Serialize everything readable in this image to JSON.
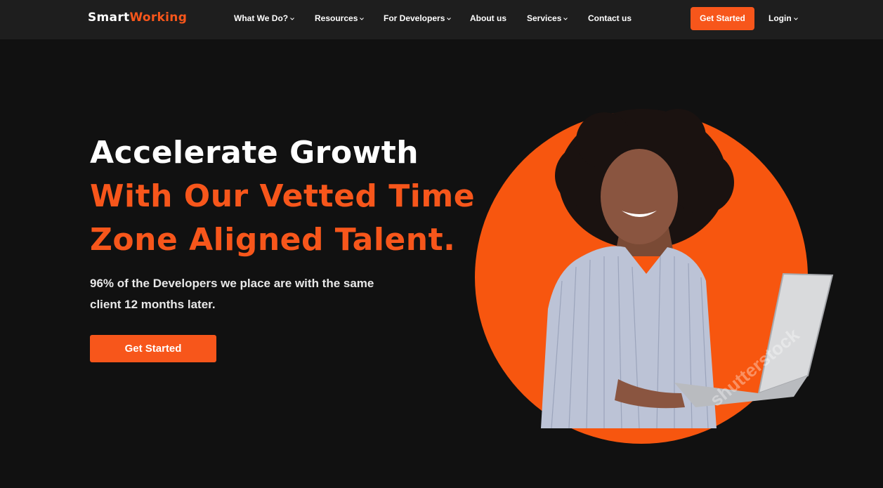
{
  "brand": {
    "name_part1": "Smart",
    "name_part2": "Working",
    "accent": "#f7561b",
    "background": "#111111",
    "nav_background": "#1e1e1e"
  },
  "nav": {
    "items": [
      {
        "label": "What We Do?",
        "dropdown": true
      },
      {
        "label": "Resources",
        "dropdown": true
      },
      {
        "label": "For Developers",
        "dropdown": true
      },
      {
        "label": "About us",
        "dropdown": false
      },
      {
        "label": "Services",
        "dropdown": true
      },
      {
        "label": "Contact us",
        "dropdown": false
      }
    ],
    "cta_label": "Get Started",
    "login_label": "Login"
  },
  "hero": {
    "heading_line1": "Accelerate Growth",
    "heading_line2": "With Our Vetted Time",
    "heading_line3": "Zone Aligned Talent.",
    "subtext": "96% of the Developers we place are with the same client 12 months later.",
    "cta_label": "Get Started",
    "image_subject": "woman-holding-laptop-on-orange-circle",
    "watermark": "shutterstock"
  }
}
